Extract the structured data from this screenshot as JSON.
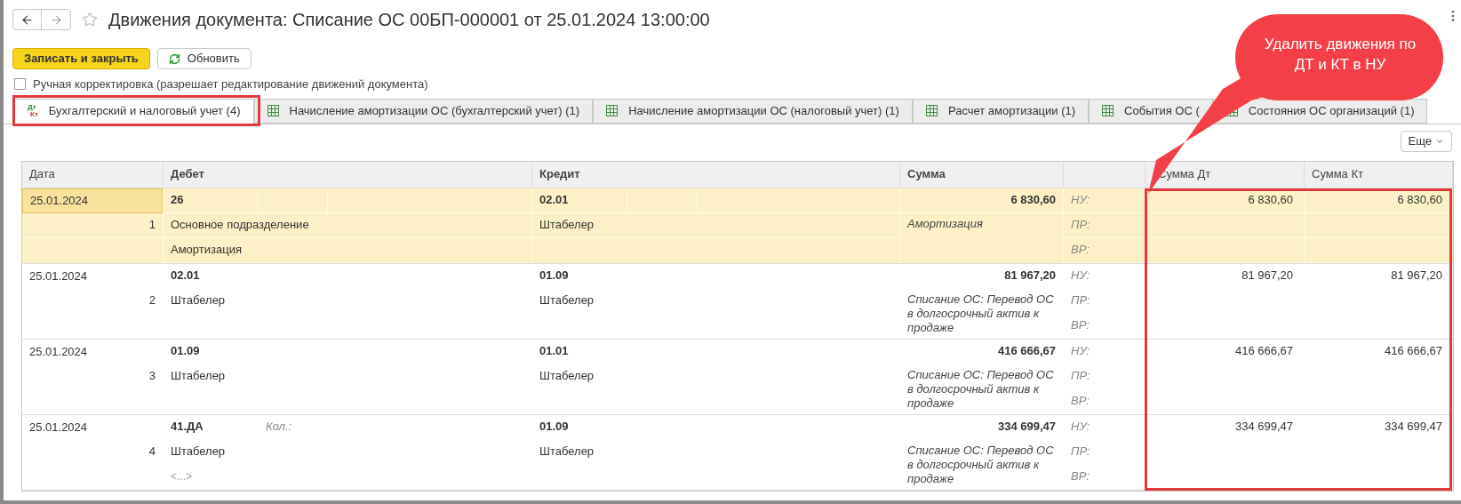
{
  "window": {
    "title": "Движения документа: Списание ОС 00БП-000001 от 25.01.2024 13:00:00",
    "favorite": false
  },
  "toolbar": [
    {
      "label": "Записать и закрыть",
      "kind": "primary"
    },
    {
      "label": "Обновить",
      "kind": "refresh"
    }
  ],
  "manual_edit": {
    "label": "Ручная корректировка (разрешает редактирование движений документа)",
    "checked": false
  },
  "tabs": [
    {
      "label": "Бухгалтерский и налоговый учет (4)",
      "selected": true,
      "icon_labels": [
        "Дт",
        "Кт"
      ]
    },
    {
      "label": "Начисление амортизации ОС (бухгалтерский учет) (1)",
      "selected": false
    },
    {
      "label": "Начисление амортизации ОС (налоговый учет) (1)",
      "selected": false
    },
    {
      "label": "Расчет амортизации (1)",
      "selected": false
    },
    {
      "label": "События ОС (",
      "selected": false
    },
    {
      "label": "Состояния ОС организаций (1)",
      "selected": false
    }
  ],
  "more_button": "Еще",
  "table": {
    "columns": [
      "Дата",
      "Дебет",
      "Кредит",
      "Сумма",
      "Сумма Дт",
      "Сумма Кт"
    ],
    "rows": [
      {
        "selected": true,
        "date": "25.01.2024",
        "number": "1",
        "debit": {
          "account": "26",
          "lines": [
            {
              "text": "Основное подразделение",
              "kind": "value"
            },
            {
              "text": "Амортизация",
              "kind": "value"
            }
          ]
        },
        "credit": {
          "account": "02.01",
          "lines": [
            {
              "text": "Штабелер",
              "kind": "value"
            }
          ]
        },
        "amount": "6 830,60",
        "description": "Амортизация",
        "registers": [
          "НУ:",
          "ПР:",
          "ВР:"
        ],
        "amount_dt": "6 830,60",
        "amount_kt": "6 830,60"
      },
      {
        "selected": false,
        "date": "25.01.2024",
        "number": "2",
        "debit": {
          "account": "02.01",
          "lines": [
            {
              "text": "Штабелер",
              "kind": "value"
            }
          ]
        },
        "credit": {
          "account": "01.09",
          "lines": [
            {
              "text": "Штабелер",
              "kind": "value"
            }
          ]
        },
        "amount": "81 967,20",
        "description": "Списание ОС: Перевод ОС в долгосрочный актив к продаже",
        "registers": [
          "НУ:",
          "ПР:",
          "ВР:"
        ],
        "amount_dt": "81 967,20",
        "amount_kt": "81 967,20"
      },
      {
        "selected": false,
        "date": "25.01.2024",
        "number": "3",
        "debit": {
          "account": "01.09",
          "lines": [
            {
              "text": "Штабелер",
              "kind": "value"
            }
          ]
        },
        "credit": {
          "account": "01.01",
          "lines": [
            {
              "text": "Штабелер",
              "kind": "value"
            }
          ]
        },
        "amount": "416 666,67",
        "description": "Списание ОС: Перевод ОС в долгосрочный актив к продаже",
        "registers": [
          "НУ:",
          "ПР:",
          "ВР:"
        ],
        "amount_dt": "416 666,67",
        "amount_kt": "416 666,67"
      },
      {
        "selected": false,
        "date": "25.01.2024",
        "number": "4",
        "debit": {
          "account": "41.ДА",
          "quantity_label": "Кол.:",
          "lines": [
            {
              "text": "Штабелер",
              "kind": "value"
            },
            {
              "text": "<...>",
              "kind": "more"
            }
          ]
        },
        "credit": {
          "account": "01.09",
          "lines": [
            {
              "text": "Штабелер",
              "kind": "value"
            }
          ]
        },
        "amount": "334 699,47",
        "description": "Списание ОС: Перевод ОС в долгосрочный актив к продаже",
        "registers": [
          "НУ:",
          "ПР:",
          "ВР:"
        ],
        "amount_dt": "334 699,47",
        "amount_kt": "334 699,47"
      }
    ]
  },
  "annotations": [
    {
      "kind": "callout",
      "text": "Удалить движения по ДТ и КТ в НУ"
    },
    {
      "kind": "tab-frame"
    },
    {
      "kind": "frame"
    }
  ]
}
